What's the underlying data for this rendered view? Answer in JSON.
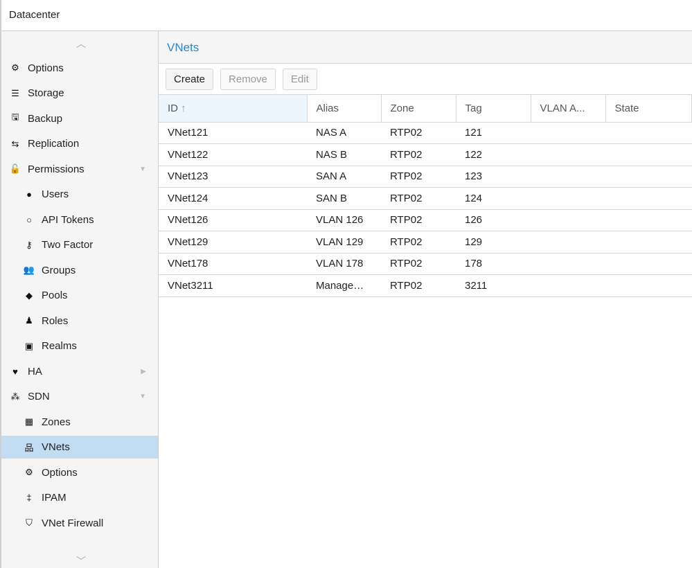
{
  "topbar": {
    "title": "Datacenter"
  },
  "sidebar": {
    "items": [
      {
        "label": "Options",
        "icon": "gear-icon",
        "glyph": "⚙",
        "level": 0
      },
      {
        "label": "Storage",
        "icon": "database-icon",
        "glyph": "☰",
        "level": 0
      },
      {
        "label": "Backup",
        "icon": "floppy-icon",
        "glyph": "🖫",
        "level": 0
      },
      {
        "label": "Replication",
        "icon": "retweet-icon",
        "glyph": "⇆",
        "level": 0
      },
      {
        "label": "Permissions",
        "icon": "unlock-icon",
        "glyph": "🔓",
        "level": 0,
        "expander": "▼"
      },
      {
        "label": "Users",
        "icon": "user-icon",
        "glyph": "●",
        "level": 1
      },
      {
        "label": "API Tokens",
        "icon": "user-outline-icon",
        "glyph": "○",
        "level": 1
      },
      {
        "label": "Two Factor",
        "icon": "key-icon",
        "glyph": "⚷",
        "level": 1
      },
      {
        "label": "Groups",
        "icon": "users-icon",
        "glyph": "👥",
        "level": 1
      },
      {
        "label": "Pools",
        "icon": "tags-icon",
        "glyph": "◆",
        "level": 1
      },
      {
        "label": "Roles",
        "icon": "male-icon",
        "glyph": "♟",
        "level": 1
      },
      {
        "label": "Realms",
        "icon": "address-book-icon",
        "glyph": "▣",
        "level": 1
      },
      {
        "label": "HA",
        "icon": "heartbeat-icon",
        "glyph": "♥",
        "level": 0,
        "expander": "▶"
      },
      {
        "label": "SDN",
        "icon": "sdn-icon",
        "glyph": "⁂",
        "level": 0,
        "expander": "▼"
      },
      {
        "label": "Zones",
        "icon": "th-icon",
        "glyph": "▦",
        "level": 1
      },
      {
        "label": "VNets",
        "icon": "sitemap-icon",
        "glyph": "品",
        "level": 1,
        "selected": true
      },
      {
        "label": "Options",
        "icon": "gear-icon",
        "glyph": "⚙",
        "level": 1
      },
      {
        "label": "IPAM",
        "icon": "signpost-icon",
        "glyph": "‡",
        "level": 1
      },
      {
        "label": "VNet Firewall",
        "icon": "shield-icon",
        "glyph": "⛉",
        "level": 1
      }
    ]
  },
  "main": {
    "title": "VNets",
    "toolbar": {
      "create": "Create",
      "remove": "Remove",
      "edit": "Edit"
    },
    "columns": [
      "ID",
      "Alias",
      "Zone",
      "Tag",
      "VLAN A...",
      "State"
    ],
    "sort_indicator": "↑",
    "rows": [
      [
        "VNet121",
        "NAS A",
        "RTP02",
        "121",
        "",
        ""
      ],
      [
        "VNet122",
        "NAS B",
        "RTP02",
        "122",
        "",
        ""
      ],
      [
        "VNet123",
        "SAN A",
        "RTP02",
        "123",
        "",
        ""
      ],
      [
        "VNet124",
        "SAN B",
        "RTP02",
        "124",
        "",
        ""
      ],
      [
        "VNet126",
        "VLAN 126",
        "RTP02",
        "126",
        "",
        ""
      ],
      [
        "VNet129",
        "VLAN 129",
        "RTP02",
        "129",
        "",
        ""
      ],
      [
        "VNet178",
        "VLAN 178",
        "RTP02",
        "178",
        "",
        ""
      ],
      [
        "VNet3211",
        "Manage…",
        "RTP02",
        "3211",
        "",
        ""
      ]
    ]
  },
  "colors": {
    "accent": "#2a86c9",
    "selected": "#c2ddf2"
  }
}
